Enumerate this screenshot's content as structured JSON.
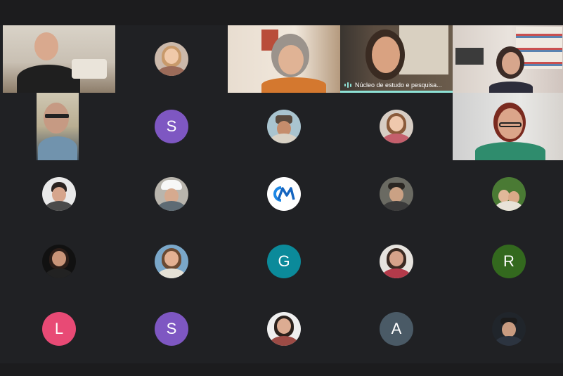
{
  "meeting": {
    "active_speaker_name": "Núcleo de estudo e pesquisa..."
  },
  "tiles": [
    {
      "kind": "video",
      "id": "t1"
    },
    {
      "kind": "photo",
      "id": "t2"
    },
    {
      "kind": "video",
      "id": "t3"
    },
    {
      "kind": "video",
      "id": "t4",
      "label": "Núcleo de estudo e pesquisa...",
      "speaking": true
    },
    {
      "kind": "video",
      "id": "t5"
    },
    {
      "kind": "video",
      "id": "t6"
    },
    {
      "kind": "initial",
      "id": "t7",
      "initial": "S",
      "color": "#7e57c2"
    },
    {
      "kind": "photo",
      "id": "t8"
    },
    {
      "kind": "photo",
      "id": "t9"
    },
    {
      "kind": "video",
      "id": "t10"
    },
    {
      "kind": "photo",
      "id": "t11"
    },
    {
      "kind": "photo",
      "id": "t12"
    },
    {
      "kind": "logo",
      "id": "t13",
      "icon": "cm-logo-icon",
      "color": "#1e88e5"
    },
    {
      "kind": "photo",
      "id": "t14"
    },
    {
      "kind": "photo",
      "id": "t15"
    },
    {
      "kind": "photo",
      "id": "t16"
    },
    {
      "kind": "photo",
      "id": "t17"
    },
    {
      "kind": "initial",
      "id": "t18",
      "initial": "G",
      "color": "#0b8a9a"
    },
    {
      "kind": "photo",
      "id": "t19"
    },
    {
      "kind": "initial",
      "id": "t20",
      "initial": "R",
      "color": "#33691e"
    },
    {
      "kind": "initial",
      "id": "t21",
      "initial": "L",
      "color": "#e84a75"
    },
    {
      "kind": "initial",
      "id": "t22",
      "initial": "S",
      "color": "#7e57c2"
    },
    {
      "kind": "photo",
      "id": "t23"
    },
    {
      "kind": "initial",
      "id": "t24",
      "initial": "A",
      "color": "#4a5a66"
    },
    {
      "kind": "photo",
      "id": "t25"
    }
  ],
  "colors": {
    "background": "#202124",
    "speaking_accent": "#8ee2d6"
  }
}
